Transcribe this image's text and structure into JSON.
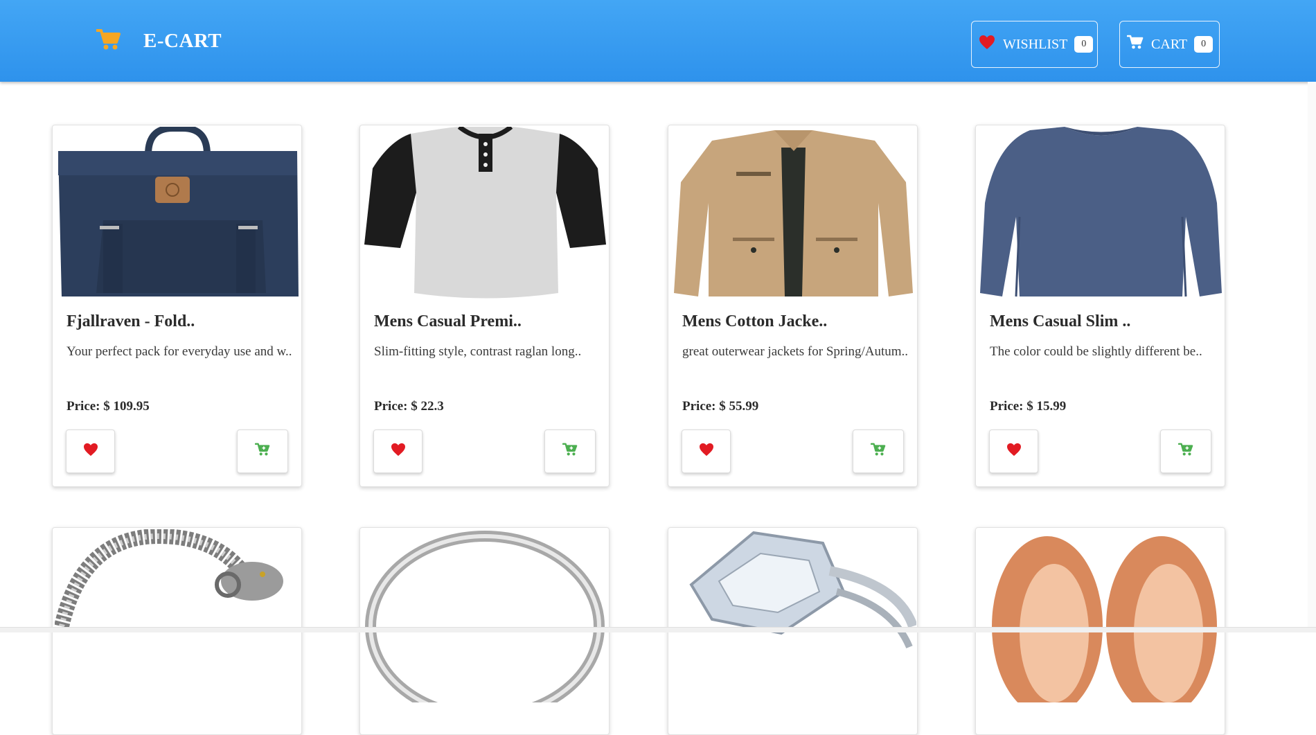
{
  "header": {
    "brand": "E-CART",
    "brand_icon": "cart-icon",
    "wishlist_label": "WISHLIST",
    "wishlist_count": "0",
    "cart_label": "CART",
    "cart_count": "0"
  },
  "colors": {
    "navbar": "#3a9ef2",
    "brand_icon": "#f5a623",
    "wishlist_heart": "#e21b23",
    "add_to_cart": "#4caf50"
  },
  "products": [
    {
      "title": "Fjallraven - Fold..",
      "description": "Your perfect pack for everyday use and w..",
      "price": "Price: $ 109.95",
      "image": "backpack"
    },
    {
      "title": "Mens Casual Premi..",
      "description": "Slim-fitting style, contrast raglan long..",
      "price": "Price: $ 22.3",
      "image": "raglan-tshirt"
    },
    {
      "title": "Mens Cotton Jacke..",
      "description": "great outerwear jackets for Spring/Autum..",
      "price": "Price: $ 55.99",
      "image": "cotton-jacket"
    },
    {
      "title": "Mens Casual Slim ..",
      "description": "The color could be slightly different be..",
      "price": "Price: $ 15.99",
      "image": "slim-shirt"
    },
    {
      "image": "dragon-bracelet"
    },
    {
      "image": "silver-ring"
    },
    {
      "image": "diamond-ring"
    },
    {
      "image": "rose-gold-tunnel-plugs"
    }
  ]
}
